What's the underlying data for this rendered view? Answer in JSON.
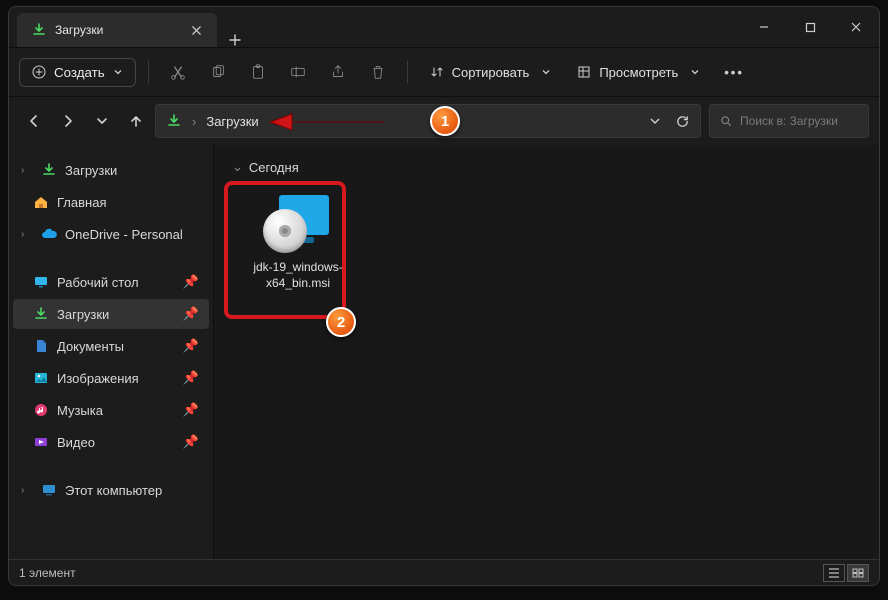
{
  "tab": {
    "title": "Загрузки"
  },
  "toolbar": {
    "create_label": "Создать",
    "sort_label": "Сортировать",
    "view_label": "Просмотреть"
  },
  "breadcrumb": {
    "current": "Загрузки"
  },
  "search": {
    "placeholder": "Поиск в: Загрузки"
  },
  "sidebar": {
    "quick": [
      {
        "label": "Загрузки",
        "icon": "download",
        "expandable": true
      },
      {
        "label": "Главная",
        "icon": "home"
      },
      {
        "label": "OneDrive - Personal",
        "icon": "cloud",
        "expandable": true
      }
    ],
    "pinned": [
      {
        "label": "Рабочий стол",
        "icon": "desktop"
      },
      {
        "label": "Загрузки",
        "icon": "download",
        "active": true
      },
      {
        "label": "Документы",
        "icon": "document"
      },
      {
        "label": "Изображения",
        "icon": "image"
      },
      {
        "label": "Музыка",
        "icon": "music"
      },
      {
        "label": "Видео",
        "icon": "video"
      }
    ],
    "drives": [
      {
        "label": "Этот компьютер",
        "icon": "pc",
        "expandable": true
      }
    ]
  },
  "content": {
    "group_header": "Сегодня",
    "files": [
      {
        "name": "jdk-19_windows-x64_bin.msi",
        "type": "msi"
      }
    ]
  },
  "status": {
    "text": "1 элемент"
  },
  "annotations": {
    "callout1": "1",
    "callout2": "2"
  }
}
